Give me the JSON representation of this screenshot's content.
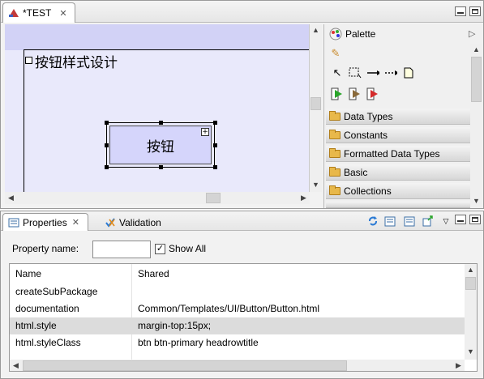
{
  "editor": {
    "tab_title": "*TEST",
    "frame_title": "按钮样式设计",
    "button_label": "按钮"
  },
  "palette": {
    "title": "Palette",
    "drawers": [
      "Data Types",
      "Constants",
      "Formatted Data Types",
      "Basic",
      "Collections"
    ]
  },
  "properties": {
    "tabs": {
      "properties": "Properties",
      "validation": "Validation"
    },
    "filter_label": "Property name:",
    "filter_value": "",
    "show_all_label": "Show All",
    "show_all_checked": true,
    "columns": [
      "Name",
      "Shared"
    ],
    "rows": [
      {
        "name": "createSubPackage",
        "value": ""
      },
      {
        "name": "documentation",
        "value": "Common/Templates/UI/Button/Button.html"
      },
      {
        "name": "html.style",
        "value": "margin-top:15px;",
        "selected": true
      },
      {
        "name": "html.styleClass",
        "value": "btn btn-primary headrowtitle"
      }
    ]
  },
  "colors": {
    "canvas_bg": "#e9e9fb",
    "canvas_band": "#d2d2f6",
    "button_fill": "#d5d5fb",
    "selected_row": "#dcdcdc"
  }
}
